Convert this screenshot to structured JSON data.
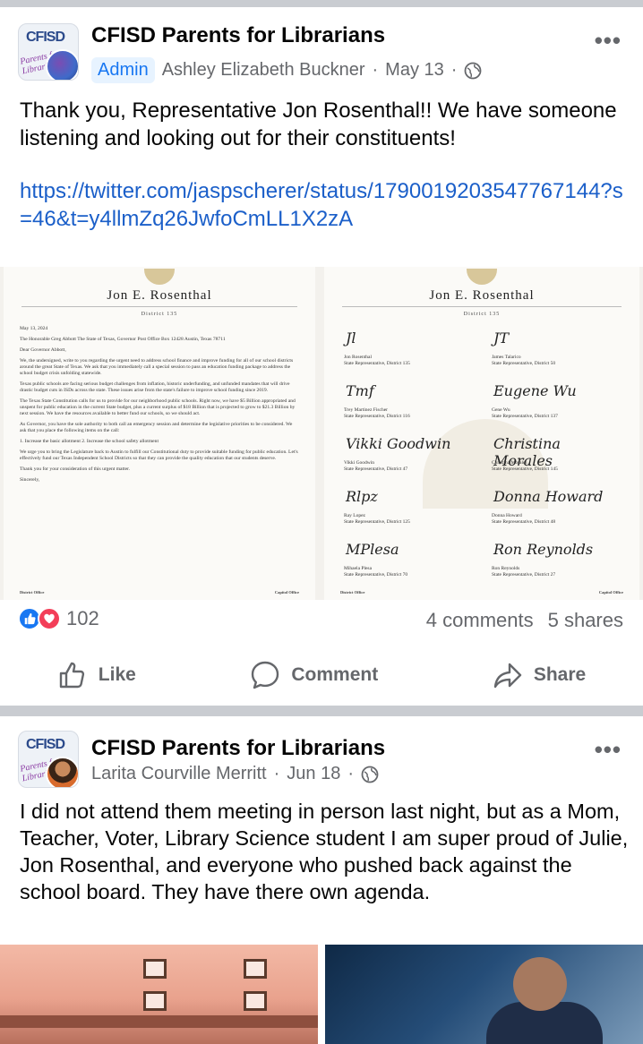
{
  "post1": {
    "group_name": "CFISD Parents for Librarians",
    "avatar_logo": "CFISD",
    "avatar_sub": "Parents for Libraries",
    "badge": "Admin",
    "author": "Ashley Elizabeth Buckner",
    "date": "May 13",
    "separator": "·",
    "body": "Thank you, Representative Jon Rosenthal!! We have someone listening and looking out for their constituents!",
    "link": "https://twitter.com/jaspscherer/status/1790019203547767144?s=46&t=y4llmZq26JwfoCmLL1X2zA",
    "letter1": {
      "header": "Jon E. Rosenthal",
      "district": "District 135",
      "paragraphs": [
        "May 13, 2024",
        "The Honorable Greg Abbott The State of Texas, Governor Post Office Box 12428 Austin, Texas 78711",
        "Dear Governor Abbott,",
        "We, the undersigned, write to you regarding the urgent need to address school finance and improve funding for all of our school districts around the great State of Texas. We ask that you immediately call a special session to pass an education funding package to address the school budget crisis unfolding statewide.",
        "Texas public schools are facing serious budget challenges from inflation, historic underfunding, and unfunded mandates that will drive drastic budget cuts in ISDs across the state. These issues arise from the state's failure to improve school funding since 2019.",
        "The Texas State Constitution calls for us to provide for our neighborhood public schools. Right now, we have $5 Billion appropriated and unspent for public education in the current State budget, plus a current surplus of $18 Billion that is projected to grow to $21.3 Billion by next session. We have the resources available to better fund our schools, so we should act.",
        "As Governor, you have the sole authority to both call an emergency session and determine the legislative priorities to be considered. We ask that you place the following items on the call:",
        "1. Increase the basic allotment 2. Increase the school safety allotment",
        "We urge you to bring the Legislature back to Austin to fulfill our Constitutional duty to provide suitable funding for public education. Let's effectively fund our Texas Independent School Districts so that they can provide the quality education that our students deserve.",
        "Thank you for your consideration of this urgent matter.",
        "Sincerely,"
      ],
      "footer_left": "District Office",
      "footer_right": "Capitol Office"
    },
    "letter2": {
      "header": "Jon E. Rosenthal",
      "district": "District 135",
      "signatures": [
        {
          "scribble": "Jl",
          "name": "Jon Rosenthal",
          "role": "State Representative, District 135"
        },
        {
          "scribble": "JT",
          "name": "James Talarico",
          "role": "State Representative, District 50"
        },
        {
          "scribble": "Tmf",
          "name": "Trey Martinez Fischer",
          "role": "State Representative, District 116"
        },
        {
          "scribble": "Eugene Wu",
          "name": "Gene Wu",
          "role": "State Representative, District 137"
        },
        {
          "scribble": "Vikki Goodwin",
          "name": "Vikki Goodwin",
          "role": "State Representative, District 47"
        },
        {
          "scribble": "Christina Morales",
          "name": "Christina Morales",
          "role": "State Representative, District 145"
        },
        {
          "scribble": "Rlpz",
          "name": "Ray Lopez",
          "role": "State Representative, District 125"
        },
        {
          "scribble": "Donna Howard",
          "name": "Donna Howard",
          "role": "State Representative, District 48"
        },
        {
          "scribble": "MPlesa",
          "name": "Mihaela Plesa",
          "role": "State Representative, District 70"
        },
        {
          "scribble": "Ron Reynolds",
          "name": "Ron Reynolds",
          "role": "State Representative, District 27"
        }
      ],
      "footer_left": "District Office",
      "footer_right": "Capitol Office"
    },
    "reaction_count": "102",
    "comments": "4 comments",
    "shares": "5 shares",
    "actions": {
      "like": "Like",
      "comment": "Comment",
      "share": "Share"
    }
  },
  "post2": {
    "group_name": "CFISD Parents for Librarians",
    "avatar_logo": "CFISD",
    "avatar_sub": "Parents for Libraries",
    "author": "Larita Courville Merritt",
    "date": "Jun 18",
    "separator": "·",
    "body": "I did not attend them meeting in person last night, but as a Mom, Teacher, Voter, Library Science student I am super proud of Julie, Jon Rosenthal, and everyone who pushed back against the school board. They have there own agenda."
  },
  "icons": {
    "more": "more-options-icon",
    "globe": "globe-icon",
    "like": "thumbs-up-icon",
    "love": "heart-icon",
    "comment": "comment-bubble-icon",
    "share": "share-arrow-icon"
  },
  "colors": {
    "accent": "#1877f2",
    "link": "#1b5fc9",
    "love": "#f33e58",
    "muted": "#65676b"
  }
}
